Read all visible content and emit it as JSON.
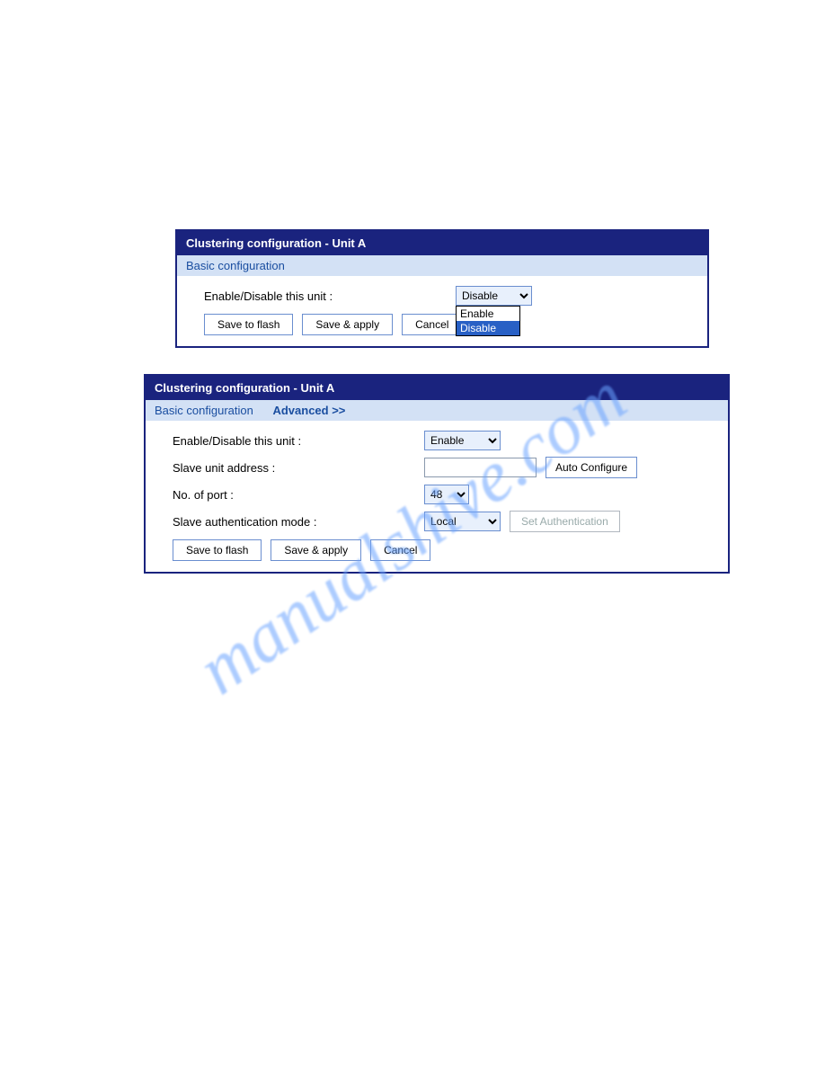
{
  "watermark": "manualshive.com",
  "panel1": {
    "title": "Clustering configuration - Unit A",
    "subheader_basic": "Basic configuration",
    "enable_label": "Enable/Disable this unit :",
    "enable_value": "Disable",
    "dropdown_options": {
      "enable": "Enable",
      "disable": "Disable"
    },
    "buttons": {
      "save_flash": "Save to flash",
      "save_apply": "Save & apply",
      "cancel": "Cancel"
    }
  },
  "panel2": {
    "title": "Clustering configuration - Unit A",
    "subheader_basic": "Basic configuration",
    "subheader_advanced": "Advanced >>",
    "enable_label": "Enable/Disable this unit :",
    "enable_value": "Enable",
    "slave_addr_label": "Slave unit address :",
    "slave_addr_value": "",
    "auto_configure": "Auto Configure",
    "num_port_label": "No. of port :",
    "num_port_value": "48",
    "auth_mode_label": "Slave authentication mode :",
    "auth_mode_value": "Local",
    "set_auth": "Set Authentication",
    "buttons": {
      "save_flash": "Save to flash",
      "save_apply": "Save & apply",
      "cancel": "Cancel"
    }
  }
}
